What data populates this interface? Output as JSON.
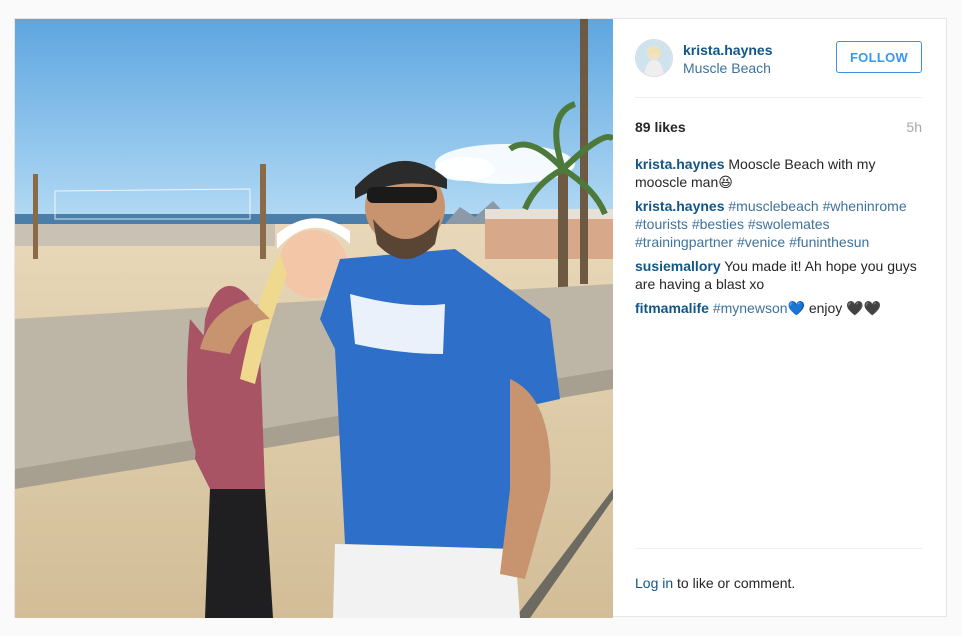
{
  "post": {
    "username": "krista.haynes",
    "location": "Muscle Beach",
    "follow_label": "FOLLOW",
    "likes": "89 likes",
    "time": "5h",
    "caption": {
      "user": "krista.haynes",
      "text": "Mooscle Beach with my mooscle man😆"
    },
    "hashtag_comment": {
      "user": "krista.haynes",
      "tags": [
        "#musclebeach",
        "#wheninrome",
        "#tourists",
        "#besties",
        "#swolemates",
        "#trainingpartner",
        "#venice",
        "#funinthesun"
      ]
    },
    "comments": [
      {
        "user": "susiemallory",
        "text": "You made it! Ah hope you guys are having a blast xo"
      }
    ],
    "last_comment": {
      "user": "fitmamalife",
      "tag": "#mynewson",
      "heart": "💙",
      "text": " enjoy",
      "hearts": "🖤🖤"
    },
    "footer": {
      "login": "Log in",
      "rest": " to like or comment."
    }
  },
  "colors": {
    "username": "#125688",
    "hashtag": "#3f729b",
    "follow": "#3897f0",
    "muted": "#a5a7aa"
  },
  "icons": {
    "avatar": "profile-avatar"
  }
}
